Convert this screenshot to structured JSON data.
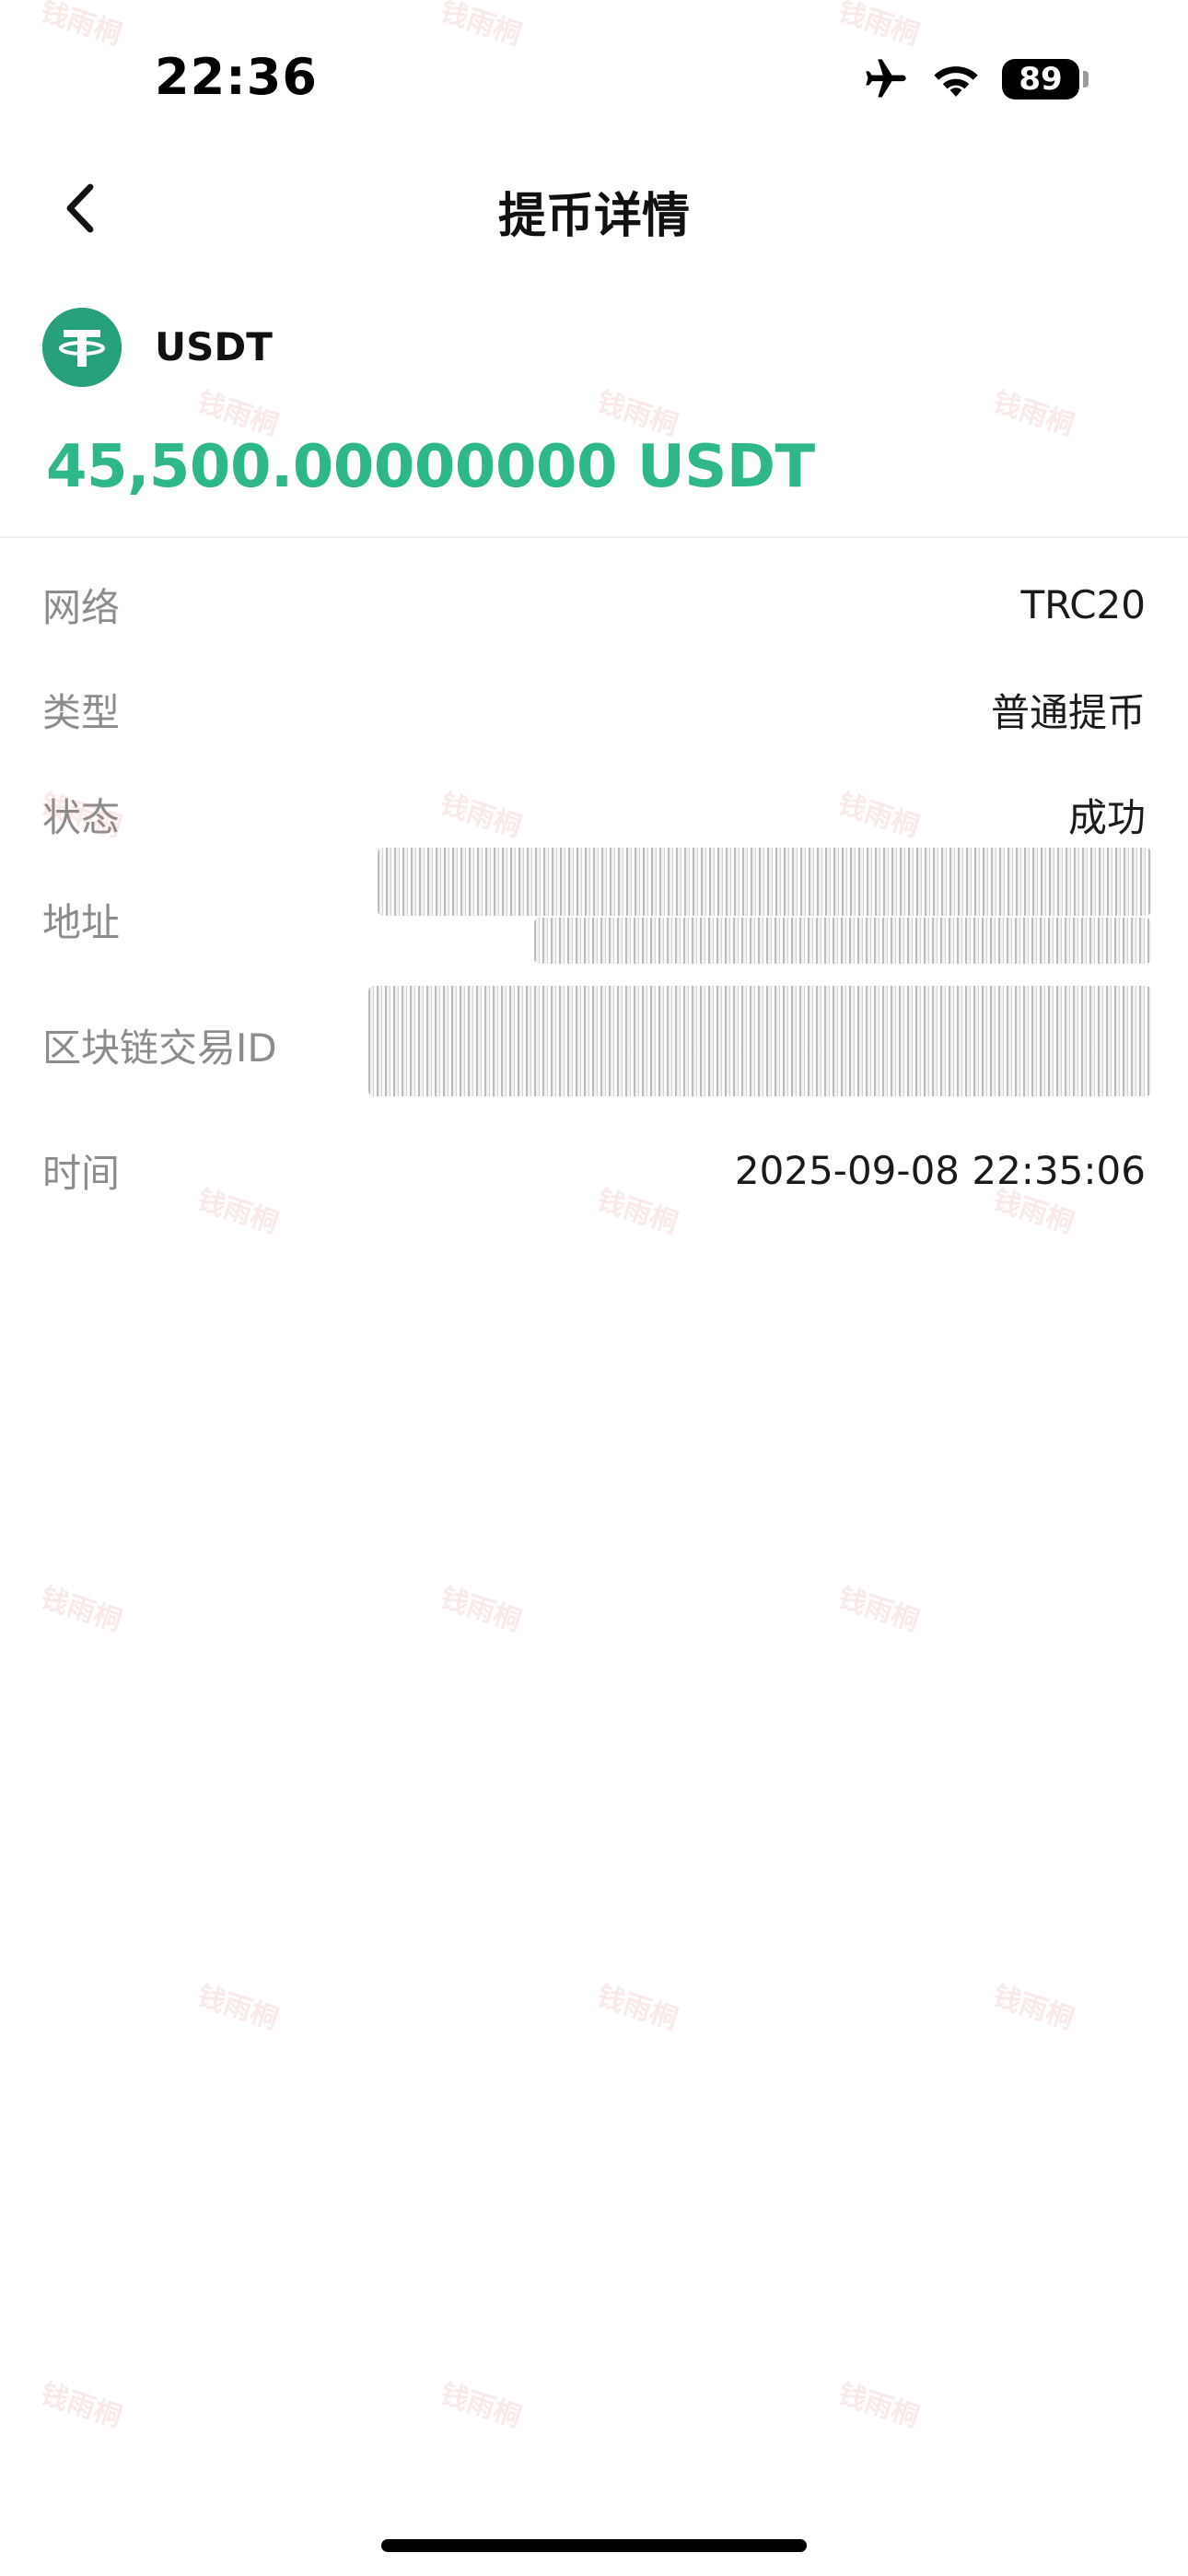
{
  "status_bar": {
    "time": "22:36",
    "battery_level": "89",
    "icons": [
      "airplane-icon",
      "wifi-icon",
      "battery-icon"
    ]
  },
  "nav": {
    "back_icon": "chevron-left-icon",
    "title": "提币详情"
  },
  "coin": {
    "logo_icon": "tether-logo-icon",
    "name": "USDT",
    "amount": "45,500.00000000 USDT",
    "amount_color": "#2fb887",
    "logo_color": "#27a17c"
  },
  "details": [
    {
      "label": "网络",
      "value": "TRC20"
    },
    {
      "label": "类型",
      "value": "普通提币"
    },
    {
      "label": "状态",
      "value": "成功"
    },
    {
      "label": "地址",
      "value": ""
    },
    {
      "label": "区块链交易ID",
      "value": ""
    },
    {
      "label": "时间",
      "value": "2025-09-08 22:35:06"
    }
  ],
  "watermark_text": "钱雨桐"
}
